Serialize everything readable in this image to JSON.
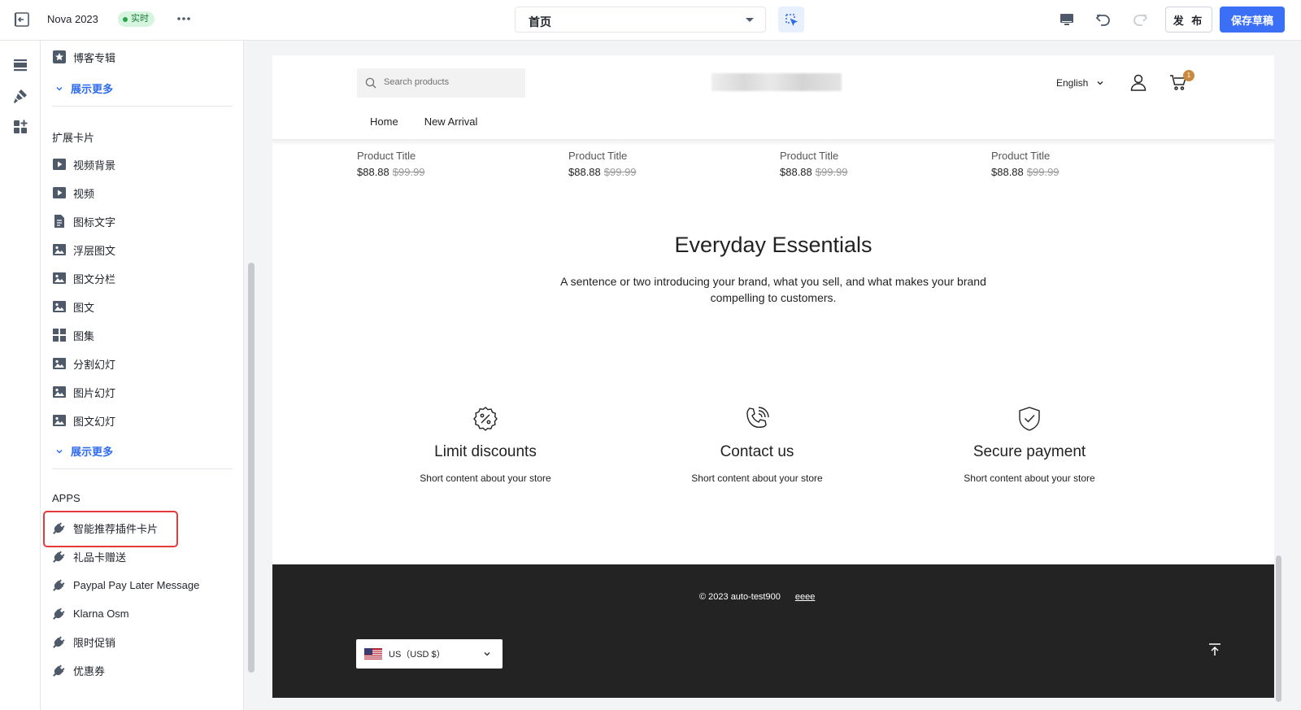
{
  "topbar": {
    "store_name": "Nova 2023",
    "status_badge": "实时",
    "page_select": "首页",
    "publish_label": "发 布",
    "save_label": "保存草稿"
  },
  "sidebar": {
    "top_items": [
      {
        "label": "博客专辑",
        "icon": "star-bookmark-icon"
      }
    ],
    "show_more_1": "展示更多",
    "section_extended": "扩展卡片",
    "extended_items": [
      {
        "label": "视频背景",
        "icon": "play-icon"
      },
      {
        "label": "视频",
        "icon": "play-icon"
      },
      {
        "label": "图标文字",
        "icon": "document-icon"
      },
      {
        "label": "浮层图文",
        "icon": "image-icon"
      },
      {
        "label": "图文分栏",
        "icon": "image-icon"
      },
      {
        "label": "图文",
        "icon": "image-icon"
      },
      {
        "label": "图集",
        "icon": "grid-icon"
      },
      {
        "label": "分割幻灯",
        "icon": "image-icon"
      },
      {
        "label": "图片幻灯",
        "icon": "image-icon"
      },
      {
        "label": "图文幻灯",
        "icon": "image-icon"
      }
    ],
    "show_more_2": "展示更多",
    "section_apps": "APPS",
    "app_items": [
      {
        "label": "智能推荐插件卡片",
        "icon": "plug-icon"
      },
      {
        "label": "礼品卡赠送",
        "icon": "plug-icon"
      },
      {
        "label": "Paypal Pay Later Message",
        "icon": "plug-icon"
      },
      {
        "label": "Klarna Osm",
        "icon": "plug-icon"
      },
      {
        "label": "限时促销",
        "icon": "plug-icon"
      },
      {
        "label": "优惠券",
        "icon": "plug-icon"
      }
    ]
  },
  "preview": {
    "search_placeholder": "Search products",
    "language": "English",
    "cart_count": "1",
    "nav": [
      "Home",
      "New Arrival"
    ],
    "products": [
      {
        "title": "Product Title",
        "price": "$88.88",
        "original": "$99.99"
      },
      {
        "title": "Product Title",
        "price": "$88.88",
        "original": "$99.99"
      },
      {
        "title": "Product Title",
        "price": "$88.88",
        "original": "$99.99"
      },
      {
        "title": "Product Title",
        "price": "$88.88",
        "original": "$99.99"
      }
    ],
    "essentials_title": "Everyday Essentials",
    "essentials_text": "A sentence or two introducing your brand, what you sell, and what makes your brand compelling to customers.",
    "features": [
      {
        "title": "Limit discounts",
        "text": "Short content about your store",
        "icon": "discount-badge-icon"
      },
      {
        "title": "Contact us",
        "text": "Short content about your store",
        "icon": "phone-icon"
      },
      {
        "title": "Secure payment",
        "text": "Short content about your store",
        "icon": "shield-check-icon"
      }
    ],
    "footer": {
      "copyright": "© 2023 auto-test900",
      "link": "eeee",
      "currency": "US（USD $）"
    }
  }
}
